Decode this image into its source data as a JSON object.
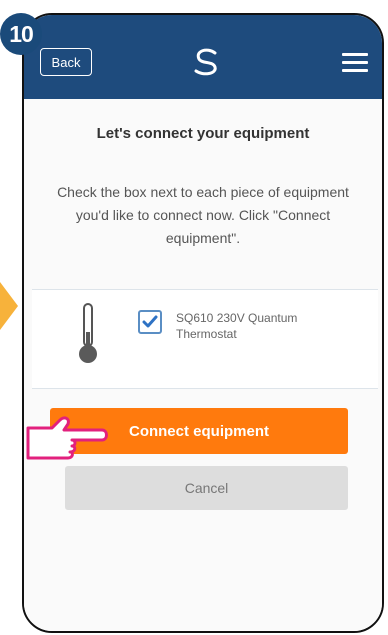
{
  "step_number": "10",
  "header": {
    "back_label": "Back",
    "logo_icon": "salus-swirl-logo",
    "menu_icon": "hamburger-menu-icon",
    "background_color": "#1e4b7d"
  },
  "main": {
    "title": "Let's connect your equipment",
    "instructions_line1": "Check the box next to each piece of equipment",
    "instructions_line2": "you'd like to connect now. Click \"Connect",
    "instructions_line3": "equipment\".",
    "equipment_items": [
      {
        "icon": "thermometer-icon",
        "checked": true,
        "label_line1": "SQ610 230V Quantum",
        "label_line2": "Thermostat"
      }
    ],
    "connect_button_label": "Connect equipment",
    "cancel_button_label": "Cancel"
  },
  "colors": {
    "accent_orange": "#ff7a0d",
    "checkbox_blue": "#2e72c4",
    "arrow_yellow": "#f7b23b",
    "pointer_magenta": "#e2207d"
  }
}
